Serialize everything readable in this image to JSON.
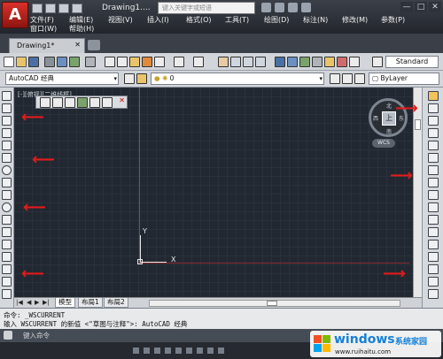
{
  "app": {
    "logo": "A",
    "title": "Drawing1....",
    "search_placeholder": "键入关键字或短语"
  },
  "menu": [
    {
      "label": "文件(F)"
    },
    {
      "label": "编辑(E)"
    },
    {
      "label": "视图(V)"
    },
    {
      "label": "插入(I)"
    },
    {
      "label": "格式(O)"
    },
    {
      "label": "工具(T)"
    },
    {
      "label": "绘图(D)"
    },
    {
      "label": "标注(N)"
    },
    {
      "label": "修改(M)"
    },
    {
      "label": "参数(P)"
    },
    {
      "label": "窗口(W)"
    },
    {
      "label": "帮助(H)"
    }
  ],
  "window_controls": {
    "min": "—",
    "max": "□",
    "close": "✕"
  },
  "tab": {
    "label": "Drawing1*",
    "close": "✕"
  },
  "toolbar": {
    "workspace": "AutoCAD 经典",
    "layer_value": "0",
    "standard_label": "Standard",
    "bylayer": "ByLayer"
  },
  "drawing": {
    "viewport_label": "[-][俯视][二维线框]",
    "ucs_x": "X",
    "ucs_y": "Y",
    "viewcube_top": "上",
    "viewcube_n": "北",
    "viewcube_s": "南",
    "viewcube_w": "西",
    "viewcube_e": "东",
    "wcs": "WCS"
  },
  "layout_tabs": {
    "model": "模型",
    "layout1": "布局1",
    "layout2": "布局2"
  },
  "command": {
    "line1": "命令: _WSCURRENT",
    "line2": "输入 WSCURRENT 的新值 <\"草图与注释\">: AutoCAD 经典",
    "prompt": "键入命令"
  },
  "watermark": {
    "brand": "windows",
    "brand2": "系统家园",
    "url": "www.ruihaitu.com"
  },
  "colors": {
    "accent_red": "#e21b1b",
    "canvas": "#222831",
    "title_bg": "#2d3139"
  }
}
